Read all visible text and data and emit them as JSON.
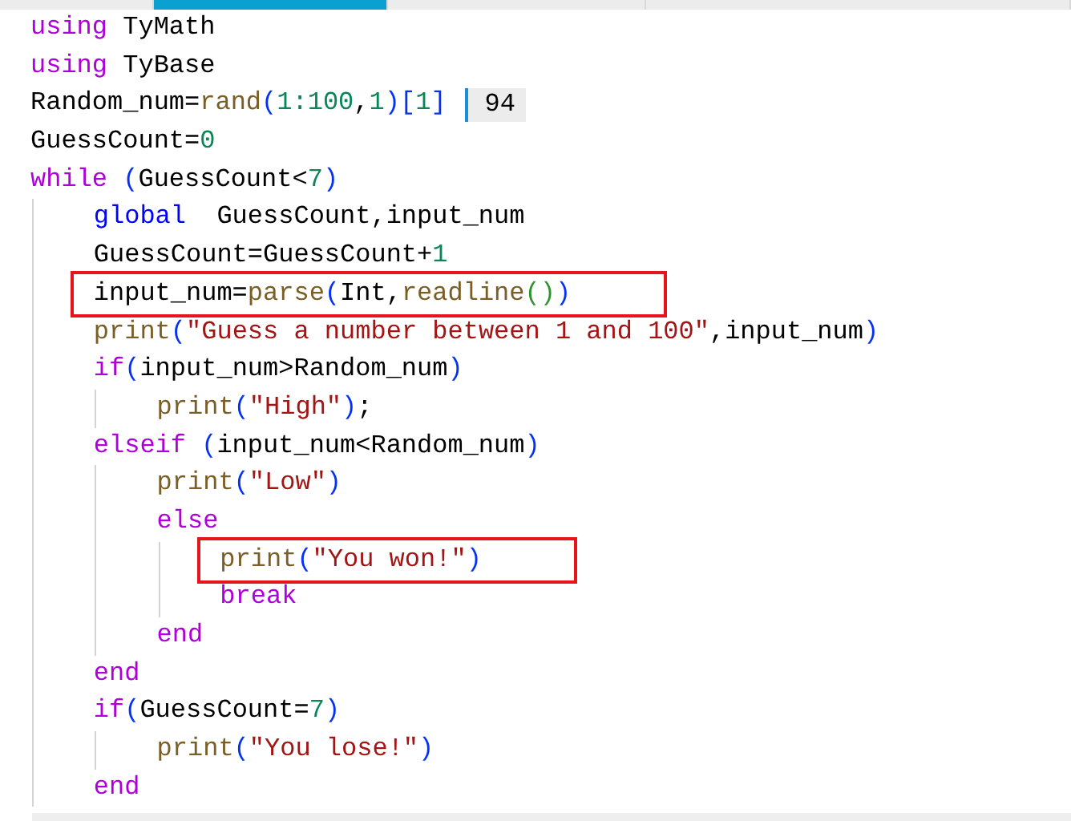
{
  "tabs": [
    {
      "selected": false
    },
    {
      "selected": true
    },
    {
      "selected": false
    },
    {
      "selected": false
    }
  ],
  "lines": [
    {
      "tokens": [
        {
          "kind": "keyword",
          "text": "using"
        },
        {
          "kind": "plain",
          "text": " TyMath"
        }
      ],
      "highlighted": false
    },
    {
      "tokens": [
        {
          "kind": "keyword",
          "text": "using"
        },
        {
          "kind": "plain",
          "text": " TyBase"
        }
      ],
      "highlighted": false
    },
    {
      "tokens": [
        {
          "kind": "plain",
          "text": "Random_num="
        },
        {
          "kind": "function",
          "text": "rand"
        },
        {
          "kind": "bracket",
          "text": "("
        },
        {
          "kind": "number",
          "text": "1:100"
        },
        {
          "kind": "plain",
          "text": ","
        },
        {
          "kind": "number",
          "text": "1"
        },
        {
          "kind": "bracket",
          "text": ")["
        },
        {
          "kind": "number",
          "text": "1"
        },
        {
          "kind": "bracket",
          "text": "]"
        }
      ],
      "highlighted": false,
      "result": "94"
    },
    {
      "tokens": [
        {
          "kind": "plain",
          "text": "GuessCount="
        },
        {
          "kind": "number",
          "text": "0"
        }
      ],
      "highlighted": false
    },
    {
      "tokens": [
        {
          "kind": "keyword",
          "text": "while"
        },
        {
          "kind": "bracket",
          "text": " ("
        },
        {
          "kind": "plain",
          "text": "GuessCount<"
        },
        {
          "kind": "number",
          "text": "7"
        },
        {
          "kind": "bracket",
          "text": ")"
        }
      ],
      "highlighted": false,
      "children": [
        {
          "tokens": [
            {
              "kind": "declaration",
              "text": "global"
            },
            {
              "kind": "plain",
              "text": "  GuessCount,input_num"
            }
          ],
          "highlighted": false
        },
        {
          "tokens": [
            {
              "kind": "plain",
              "text": "GuessCount=GuessCount+"
            },
            {
              "kind": "number",
              "text": "1"
            }
          ],
          "highlighted": false
        },
        {
          "tokens": [
            {
              "kind": "plain",
              "text": "input_num="
            },
            {
              "kind": "function",
              "text": "parse"
            },
            {
              "kind": "bracket",
              "text": "("
            },
            {
              "kind": "plain",
              "text": "Int,"
            },
            {
              "kind": "function",
              "text": "readline"
            },
            {
              "kind": "inner_bracket",
              "text": "()"
            },
            {
              "kind": "bracket",
              "text": ")"
            }
          ],
          "highlighted": true
        },
        {
          "tokens": [
            {
              "kind": "function",
              "text": "print"
            },
            {
              "kind": "bracket",
              "text": "("
            },
            {
              "kind": "string",
              "text": "\"Guess a number between 1 and 100\""
            },
            {
              "kind": "plain",
              "text": ",input_num"
            },
            {
              "kind": "bracket",
              "text": ")"
            }
          ],
          "highlighted": false
        },
        {
          "tokens": [
            {
              "kind": "keyword",
              "text": "if"
            },
            {
              "kind": "bracket",
              "text": "("
            },
            {
              "kind": "plain",
              "text": "input_num>Random_num"
            },
            {
              "kind": "bracket",
              "text": ")"
            }
          ],
          "highlighted": false,
          "children": [
            {
              "tokens": [
                {
                  "kind": "function",
                  "text": "print"
                },
                {
                  "kind": "bracket",
                  "text": "("
                },
                {
                  "kind": "string",
                  "text": "\"High\""
                },
                {
                  "kind": "bracket",
                  "text": ")"
                },
                {
                  "kind": "plain",
                  "text": ";"
                }
              ],
              "highlighted": false
            }
          ]
        },
        {
          "tokens": [
            {
              "kind": "keyword",
              "text": "elseif"
            },
            {
              "kind": "bracket",
              "text": " ("
            },
            {
              "kind": "plain",
              "text": "input_num<Random_num"
            },
            {
              "kind": "bracket",
              "text": ")"
            }
          ],
          "highlighted": false,
          "children": [
            {
              "tokens": [
                {
                  "kind": "function",
                  "text": "print"
                },
                {
                  "kind": "bracket",
                  "text": "("
                },
                {
                  "kind": "string",
                  "text": "\"Low\""
                },
                {
                  "kind": "bracket",
                  "text": ")"
                }
              ],
              "highlighted": false
            },
            {
              "tokens": [
                {
                  "kind": "keyword",
                  "text": "else"
                }
              ],
              "highlighted": false,
              "children": [
                {
                  "tokens": [
                    {
                      "kind": "function",
                      "text": "print"
                    },
                    {
                      "kind": "bracket",
                      "text": "("
                    },
                    {
                      "kind": "string",
                      "text": "\"You won!\""
                    },
                    {
                      "kind": "bracket",
                      "text": ")"
                    }
                  ],
                  "highlighted": true
                },
                {
                  "tokens": [
                    {
                      "kind": "keyword",
                      "text": "break"
                    }
                  ],
                  "highlighted": false
                }
              ]
            },
            {
              "tokens": [
                {
                  "kind": "keyword",
                  "text": "end"
                }
              ],
              "highlighted": false
            }
          ]
        },
        {
          "tokens": [
            {
              "kind": "keyword",
              "text": "end"
            }
          ],
          "highlighted": false
        },
        {
          "tokens": [
            {
              "kind": "keyword",
              "text": "if"
            },
            {
              "kind": "bracket",
              "text": "("
            },
            {
              "kind": "plain",
              "text": "GuessCount="
            },
            {
              "kind": "number",
              "text": "7"
            },
            {
              "kind": "bracket",
              "text": ")"
            }
          ],
          "highlighted": false,
          "children": [
            {
              "tokens": [
                {
                  "kind": "function",
                  "text": "print"
                },
                {
                  "kind": "bracket",
                  "text": "("
                },
                {
                  "kind": "string",
                  "text": "\"You lose!\""
                },
                {
                  "kind": "bracket",
                  "text": ")"
                }
              ],
              "highlighted": false
            }
          ]
        },
        {
          "tokens": [
            {
              "kind": "keyword",
              "text": "end"
            }
          ],
          "highlighted": false
        }
      ]
    }
  ]
}
